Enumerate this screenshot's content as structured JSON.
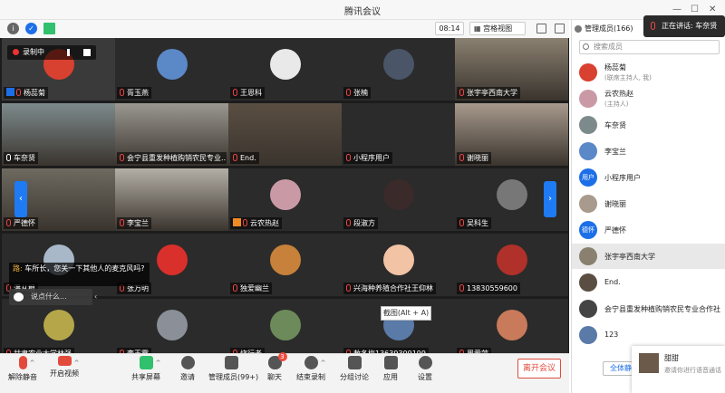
{
  "window": {
    "title": "腾讯会议"
  },
  "infobar": {
    "timer": "08:14",
    "view_mode": "宫格视图"
  },
  "recording": {
    "label": "录制中"
  },
  "tiles": [
    {
      "name": "杨蕊菊",
      "role": "host",
      "bg": "#3a3a3a",
      "avatar": "#d8402f"
    },
    {
      "name": "胥玉燕",
      "bg": "#2b2b2b",
      "avatar": "#5b88c6"
    },
    {
      "name": "王恩科",
      "bg": "#2b2b2b",
      "avatar": "#e9e9e9"
    },
    {
      "name": "张楠",
      "bg": "#2b2b2b",
      "avatar": "#4a5568"
    },
    {
      "name": "张宇亭西南大学",
      "bg": "#8a8070",
      "video": true
    },
    {
      "name": "车奈贤",
      "active": true,
      "bg": "#7d8a8c",
      "video": true
    },
    {
      "name": "会宁县重发种植购销农民专业...",
      "bg": "#9a9890",
      "video": true
    },
    {
      "name": "End.",
      "bg": "#5a4e42",
      "video": true
    },
    {
      "name": "小程序用户",
      "bg": "#2b2b2b"
    },
    {
      "name": "谢晓丽",
      "bg": "#a89a8c",
      "video": true
    },
    {
      "name": "严德怀",
      "bg": "#6e6a60",
      "video": true
    },
    {
      "name": "李宝兰",
      "bg": "#b4afa6",
      "video": true
    },
    {
      "name": "云农热赵",
      "role": "manager",
      "bg": "#2b2b2b",
      "avatar": "#c99aa6"
    },
    {
      "name": "段淑方",
      "bg": "#2b2b2b",
      "avatar": "#3b2a2a"
    },
    {
      "name": "吴科生",
      "bg": "#2b2b2b",
      "avatar": "#777777"
    },
    {
      "name": "潘从根",
      "bg": "#2b2b2b",
      "avatar": "#a8b8c8"
    },
    {
      "name": "张万明",
      "bg": "#2b2b2b",
      "avatar": "#d9302c"
    },
    {
      "name": "独爱幽兰",
      "bg": "#2b2b2b",
      "avatar": "#c7813a"
    },
    {
      "name": "兴海种养殖合作社王仰林",
      "bg": "#2b2b2b",
      "avatar": "#f2c3a4"
    },
    {
      "name": "13830559600",
      "bg": "#2b2b2b",
      "avatar": "#b0302a"
    },
    {
      "name": "甘肃农业大学林强",
      "bg": "#2b2b2b",
      "avatar": "#b5a64a"
    },
    {
      "name": "李玉霞",
      "bg": "#2b2b2b",
      "avatar": "#8a8f98"
    },
    {
      "name": "烧行者",
      "bg": "#2b2b2b",
      "avatar": "#6d8a5a"
    },
    {
      "name": "敖冬梅13639309199",
      "bg": "#2b2b2b",
      "avatar": "#5a7aa8"
    },
    {
      "name": "周爱萍",
      "bg": "#2b2b2b",
      "avatar": "#c87a5a"
    }
  ],
  "chat": {
    "sender": "路:",
    "message": "车所长，您关一下其他人的麦克风吗?",
    "input_placeholder": "说点什么..."
  },
  "tooltip": "截图(Alt + A)",
  "toolbar": {
    "mute": "解除静音",
    "video": "开启视频",
    "share": "共享屏幕",
    "invite": "邀请",
    "members": "管理成员(99+)",
    "chat": "聊天",
    "chat_badge": "3",
    "record": "结束录制",
    "breakout": "分组讨论",
    "apps": "应用",
    "settings": "设置",
    "leave": "离开会议"
  },
  "panel": {
    "header": "管理成员(166)",
    "speaking_label": "正在讲话: 车奈贤",
    "search_placeholder": "搜索成员",
    "members": [
      {
        "name": "杨蕊菊",
        "sub": "(联席主持人, 我)",
        "color": "#d8402f"
      },
      {
        "name": "云农热赵",
        "sub": "(主持人)",
        "color": "#c99aa6"
      },
      {
        "name": "车奈贤",
        "color": "#7d8a8c"
      },
      {
        "name": "李宝兰",
        "color": "#5b88c6"
      },
      {
        "name": "小程序用户",
        "color": "#1d6fe8",
        "avatar_text": "用户"
      },
      {
        "name": "谢晓丽",
        "color": "#a89a8c"
      },
      {
        "name": "严德怀",
        "color": "#1d6fe8",
        "avatar_text": "德怀"
      },
      {
        "name": "张宇亭西南大学",
        "color": "#8a8070",
        "selected": true
      },
      {
        "name": "End.",
        "color": "#5a4e42"
      },
      {
        "name": "会宁县重发种植购销农民专业合作社",
        "color": "#444444"
      },
      {
        "name": "123",
        "color": "#5a7aa8"
      }
    ],
    "mute_all": "全体静"
  },
  "notification": {
    "name": "甜甜",
    "text": "邀请你进行语音通话"
  }
}
